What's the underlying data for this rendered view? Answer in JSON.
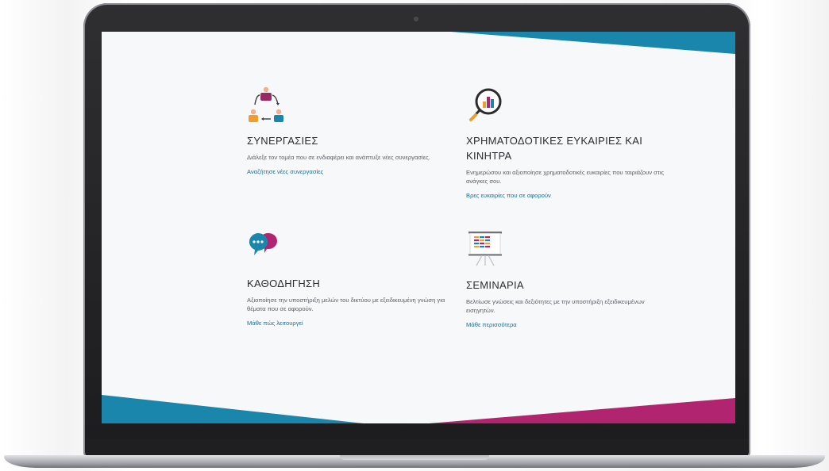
{
  "colors": {
    "teal": "#1b86ab",
    "magenta": "#b1246f",
    "screen_bg": "#f7f8fa",
    "link": "#1a6f95"
  },
  "cards": [
    {
      "icon": "collaboration-icon",
      "title": "ΣΥΝΕΡΓΑΣΙΕΣ",
      "description": "Διάλεξε τον τομέα που σε ενδιαφέρει και ανάπτυξε νέες συνεργασίες.",
      "link": "Αναζήτησε νέες συνεργασίες"
    },
    {
      "icon": "magnifier-chart-icon",
      "title": "ΧΡΗΜΑΤΟΔΟΤΙΚΕΣ ΕΥΚΑΙΡΙΕΣ ΚΑΙ ΚΙΝΗΤΡΑ",
      "description": "Ενημερώσου και αξιοποίησε χρηματοδοτικές ευκαιρίες που ταιριάζουν στις ανάγκες σου.",
      "link": "Βρες ευκαιρίες που σε αφορούν"
    },
    {
      "icon": "speech-bubbles-icon",
      "title": "ΚΑΘΟΔΗΓΗΣΗ",
      "description": "Αξιοποίησε την υποστήριξη μελών του δικτύου με εξειδικευμένη γνώση για θέματα που σε αφορούν.",
      "link": "Μάθε πώς λειτουργεί"
    },
    {
      "icon": "presentation-board-icon",
      "title": "ΣΕΜΙΝΑΡΙΑ",
      "description": "Βελτίωσε γνώσεις και δεξιότητες με την υποστήριξη εξειδικευμένων εισηγητών.",
      "link": "Μάθε περισσότερα"
    }
  ]
}
